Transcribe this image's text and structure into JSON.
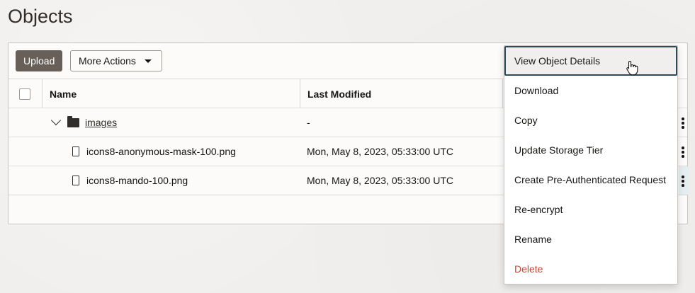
{
  "page": {
    "title": "Objects"
  },
  "toolbar": {
    "upload_label": "Upload",
    "more_actions_label": "More Actions"
  },
  "table": {
    "columns": [
      "Name",
      "Last Modified"
    ],
    "rows": [
      {
        "type": "folder",
        "name": "images",
        "last_modified": "-"
      },
      {
        "type": "file",
        "name": "icons8-anonymous-mask-100.png",
        "last_modified": "Mon, May 8, 2023, 05:33:00 UTC"
      },
      {
        "type": "file",
        "name": "icons8-mando-100.png",
        "last_modified": "Mon, May 8, 2023, 05:33:00 UTC"
      }
    ]
  },
  "context_menu": {
    "items": [
      {
        "label": "View Object Details",
        "state": "hovered"
      },
      {
        "label": "Download"
      },
      {
        "label": "Copy"
      },
      {
        "label": "Update Storage Tier"
      },
      {
        "label": "Create Pre-Authenticated Request"
      },
      {
        "label": "Re-encrypt"
      },
      {
        "label": "Rename"
      },
      {
        "label": "Delete",
        "variant": "danger"
      }
    ]
  },
  "colors": {
    "primary_button": "#685f58",
    "danger_text": "#c74634",
    "focus_outline": "#2c4b59",
    "background": "#f1efed"
  },
  "icons": {
    "folder": "folder-icon",
    "file": "file-icon",
    "expand": "chevron-down-icon",
    "row_actions": "kebab-menu-icon",
    "dropdown": "caret-down-icon",
    "pointer": "hand-pointer-cursor-icon"
  }
}
